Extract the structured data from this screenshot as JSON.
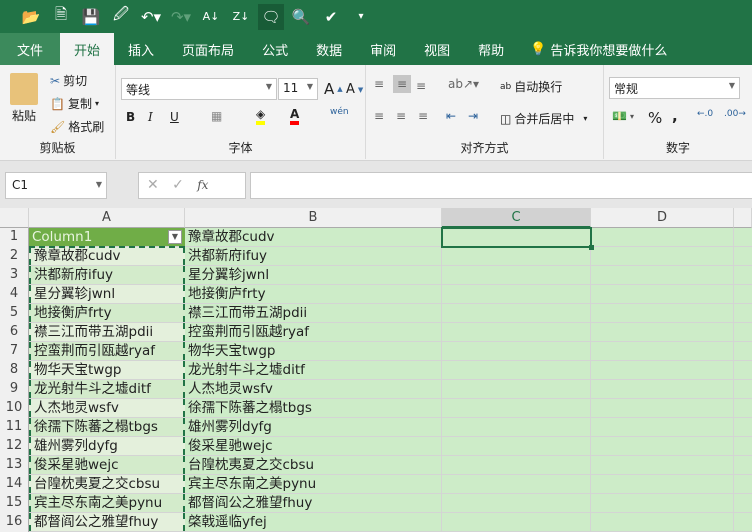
{
  "qat": {
    "icons": [
      "open-icon",
      "new-icon",
      "save-icon",
      "save-as-icon",
      "undo-icon",
      "redo-icon",
      "sort-asc-icon",
      "sort-desc-icon",
      "comment-icon",
      "print-preview-icon",
      "share-icon",
      "customize-icon"
    ]
  },
  "tabs": [
    "文件",
    "开始",
    "插入",
    "页面布局",
    "公式",
    "数据",
    "审阅",
    "视图",
    "帮助"
  ],
  "tell_me": "告诉我你想要做什么",
  "clipboard": {
    "paste": "粘贴",
    "cut": "剪切",
    "copy": "复制",
    "format_painter": "格式刷",
    "label": "剪贴板"
  },
  "font": {
    "name": "等线",
    "size": "11",
    "label": "字体",
    "bold": "B",
    "italic": "I",
    "underline": "U",
    "phonetic": "wén"
  },
  "align": {
    "wrap": "自动换行",
    "merge": "合并后居中",
    "label": "对齐方式"
  },
  "number": {
    "format": "常规",
    "label": "数字",
    "percent": "%",
    "comma": ","
  },
  "formula_bar": {
    "name_box": "C1",
    "value": ""
  },
  "columns": [
    "A",
    "B",
    "C",
    "D"
  ],
  "colors": {
    "brand": "#217346",
    "row_fill": "#cdecc8",
    "table_light": "#e4f0dc",
    "table_dark": "#d3ebcb",
    "header_fill": "#70ad47"
  },
  "rows": [
    {
      "n": "1",
      "a": "Column1",
      "b": "豫章故郡cudv"
    },
    {
      "n": "2",
      "a": "豫章故郡cudv",
      "b": "洪都新府ifuy"
    },
    {
      "n": "3",
      "a": "洪都新府ifuy",
      "b": "星分翼轸jwnl"
    },
    {
      "n": "4",
      "a": "星分翼轸jwnl",
      "b": "地接衡庐frty"
    },
    {
      "n": "5",
      "a": "地接衡庐frty",
      "b": "襟三江而带五湖pdii"
    },
    {
      "n": "6",
      "a": "襟三江而带五湖pdii",
      "b": "控蛮荆而引瓯越ryaf"
    },
    {
      "n": "7",
      "a": "控蛮荆而引瓯越ryaf",
      "b": "物华天宝twgp"
    },
    {
      "n": "8",
      "a": "物华天宝twgp",
      "b": "龙光射牛斗之墟ditf"
    },
    {
      "n": "9",
      "a": "龙光射牛斗之墟ditf",
      "b": "人杰地灵wsfv"
    },
    {
      "n": "10",
      "a": "人杰地灵wsfv",
      "b": "徐孺下陈蕃之榻tbgs"
    },
    {
      "n": "11",
      "a": "徐孺下陈蕃之榻tbgs",
      "b": "雄州雾列dyfg"
    },
    {
      "n": "12",
      "a": "雄州雾列dyfg",
      "b": "俊采星驰wejc"
    },
    {
      "n": "13",
      "a": "俊采星驰wejc",
      "b": "台隍枕夷夏之交cbsu"
    },
    {
      "n": "14",
      "a": "台隍枕夷夏之交cbsu",
      "b": "宾主尽东南之美pynu"
    },
    {
      "n": "15",
      "a": "宾主尽东南之美pynu",
      "b": "都督阎公之雅望fhuy"
    },
    {
      "n": "16",
      "a": "都督阎公之雅望fhuy",
      "b": "棨戟遥临yfej"
    }
  ]
}
